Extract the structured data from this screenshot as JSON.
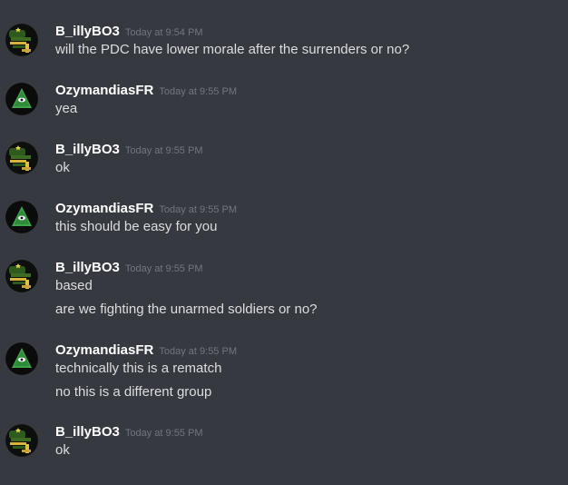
{
  "colors": {
    "background": "#36393f",
    "username": "#ffffff",
    "message_text": "#dcddde",
    "timestamp": "#72767d"
  },
  "messages": [
    {
      "avatar_icon": "soldier-avatar-icon",
      "author": "B_illyBO3",
      "timestamp": "Today at 9:54 PM",
      "lines": [
        "will the PDC have lower morale after the surrenders or no?"
      ]
    },
    {
      "avatar_icon": "eye-pyramid-avatar-icon",
      "author": "OzymandiasFR",
      "timestamp": "Today at 9:55 PM",
      "lines": [
        "yea"
      ]
    },
    {
      "avatar_icon": "soldier-avatar-icon",
      "author": "B_illyBO3",
      "timestamp": "Today at 9:55 PM",
      "lines": [
        "ok"
      ]
    },
    {
      "avatar_icon": "eye-pyramid-avatar-icon",
      "author": "OzymandiasFR",
      "timestamp": "Today at 9:55 PM",
      "lines": [
        "this should be easy for you"
      ]
    },
    {
      "avatar_icon": "soldier-avatar-icon",
      "author": "B_illyBO3",
      "timestamp": "Today at 9:55 PM",
      "lines": [
        "based",
        "are we fighting the unarmed soldiers or no?"
      ]
    },
    {
      "avatar_icon": "eye-pyramid-avatar-icon",
      "author": "OzymandiasFR",
      "timestamp": "Today at 9:55 PM",
      "lines": [
        "technically this is a rematch",
        "no this is a different group"
      ]
    },
    {
      "avatar_icon": "soldier-avatar-icon",
      "author": "B_illyBO3",
      "timestamp": "Today at 9:55 PM",
      "lines": [
        "ok"
      ]
    }
  ]
}
